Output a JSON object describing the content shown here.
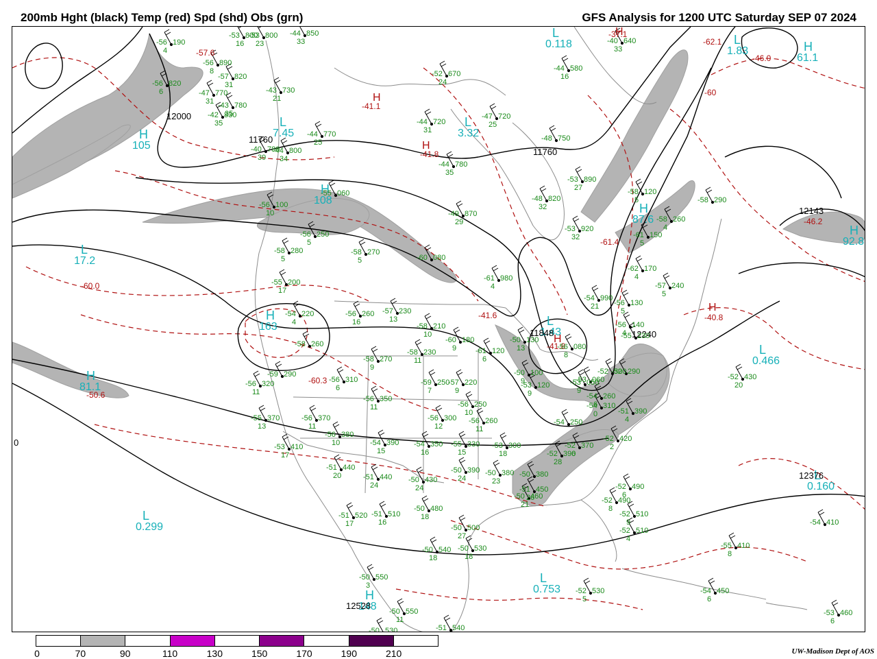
{
  "title_left": "200mb Hght (black) Temp (red) Spd (shd) Obs (grn)",
  "title_right": "GFS Analysis for 1200 UTC Saturday  SEP 07 2024",
  "credit": "UW-Madison  Dept of AOS",
  "edge_label": "0",
  "colorbar": {
    "ticks": [
      "0",
      "70",
      "90",
      "110",
      "130",
      "150",
      "170",
      "190",
      "210"
    ],
    "segments": [
      "#ffffff",
      "#b4b4b4",
      "#ffffff",
      "#c800c8",
      "#ffffff",
      "#8c008c",
      "#ffffff",
      "#500050",
      "#ffffff"
    ]
  },
  "colors": {
    "heights": "#000000",
    "temperature": "#b01010",
    "wind_speed_shading": "#b4b4b4",
    "observations": "#1a8a1a",
    "centers": "#16b0b8",
    "geography": "#8c8c8c"
  },
  "centers": [
    {
      "mark": "L",
      "value": "0.118"
    },
    {
      "mark": "L",
      "value": "1.83"
    },
    {
      "mark": "H",
      "value": "61.1"
    },
    {
      "mark": "H",
      "value": "105"
    },
    {
      "mark": "L",
      "value": "7.45"
    },
    {
      "mark": "L",
      "value": "3.32"
    },
    {
      "mark": "H",
      "value": "108"
    },
    {
      "mark": "L",
      "value": "17.2"
    },
    {
      "mark": "H",
      "value": "87.6"
    },
    {
      "mark": "H",
      "value": "92.8"
    },
    {
      "mark": "H",
      "value": "163"
    },
    {
      "mark": "L",
      "value": "1.43"
    },
    {
      "mark": "L",
      "value": "0.466"
    },
    {
      "mark": "H",
      "value": "81.1"
    },
    {
      "mark": "L",
      "value": "0.160"
    },
    {
      "mark": "L",
      "value": "0.299"
    },
    {
      "mark": "L",
      "value": "0.753"
    },
    {
      "mark": "H",
      "value": "148"
    }
  ],
  "heights": [
    "12000",
    "11760",
    "11760",
    "12143",
    "12240",
    "12376",
    "12528",
    "11848"
  ],
  "temperatures": [
    "-57.6",
    "-41.1",
    "-41.8",
    "-37.1",
    "-62.1",
    "-46.0",
    "-60",
    "-60.0",
    "-61.4",
    "-46.2",
    "-60.3",
    "-50.6",
    "-40.8",
    "-41.8",
    "-41.6"
  ],
  "temp_marks": [
    "H",
    "H",
    "H",
    "H",
    "H"
  ],
  "observations": [
    {
      "t": "-56",
      "h": "190",
      "d": "4"
    },
    {
      "t": "-53",
      "h": "800",
      "d": "16"
    },
    {
      "t": "-53",
      "h": "800",
      "d": "23"
    },
    {
      "t": "-44",
      "h": "850",
      "d": "33"
    },
    {
      "t": "-56",
      "h": "890",
      "d": "8"
    },
    {
      "t": "-57",
      "h": "820",
      "d": "31"
    },
    {
      "t": "-56",
      "h": "820",
      "d": "6"
    },
    {
      "t": "-47",
      "h": "770",
      "d": "31"
    },
    {
      "t": "-43",
      "h": "730",
      "d": "21"
    },
    {
      "t": "-43",
      "h": "780",
      "d": "35"
    },
    {
      "t": "-42",
      "h": "830",
      "d": "35"
    },
    {
      "t": "-44",
      "h": "770",
      "d": "25"
    },
    {
      "t": "-44",
      "h": "720",
      "d": "31"
    },
    {
      "t": "-47",
      "h": "720",
      "d": "25"
    },
    {
      "t": "-52",
      "h": "670",
      "d": "24"
    },
    {
      "t": "-44",
      "h": "580",
      "d": "16"
    },
    {
      "t": "-40",
      "h": "640",
      "d": "33"
    },
    {
      "t": "-48",
      "h": "750",
      "d": ""
    },
    {
      "t": "-44",
      "h": "780",
      "d": "35"
    },
    {
      "t": "-44",
      "h": "800",
      "d": "34"
    },
    {
      "t": "-40",
      "h": "780",
      "d": "39"
    },
    {
      "t": "-53",
      "h": "890",
      "d": "27"
    },
    {
      "t": "-48",
      "h": "820",
      "d": "32"
    },
    {
      "t": "-49",
      "h": "870",
      "d": "29"
    },
    {
      "t": "-53",
      "h": "920",
      "d": "32"
    },
    {
      "t": "-56",
      "h": "100",
      "d": "10"
    },
    {
      "t": "-55",
      "h": "060",
      "d": ""
    },
    {
      "t": "-56",
      "h": "250",
      "d": "5"
    },
    {
      "t": "-58",
      "h": "280",
      "d": "5"
    },
    {
      "t": "-58",
      "h": "270",
      "d": "5"
    },
    {
      "t": "-60",
      "h": "080",
      "d": ""
    },
    {
      "t": "-58",
      "h": "120",
      "d": "5"
    },
    {
      "t": "-58",
      "h": "260",
      "d": "4"
    },
    {
      "t": "-58",
      "h": "290",
      "d": ""
    },
    {
      "t": "-61",
      "h": "150",
      "d": "5"
    },
    {
      "t": "-61",
      "h": "980",
      "d": "4"
    },
    {
      "t": "-57",
      "h": "240",
      "d": "5"
    },
    {
      "t": "-56",
      "h": "130",
      "d": "5"
    },
    {
      "t": "-54",
      "h": "990",
      "d": "21"
    },
    {
      "t": "-62",
      "h": "170",
      "d": "4"
    },
    {
      "t": "-55",
      "h": "200",
      "d": "17"
    },
    {
      "t": "-54",
      "h": "220",
      "d": "4"
    },
    {
      "t": "-56",
      "h": "260",
      "d": "16"
    },
    {
      "t": "-57",
      "h": "230",
      "d": "13"
    },
    {
      "t": "-58",
      "h": "210",
      "d": "10"
    },
    {
      "t": "-60",
      "h": "180",
      "d": "9"
    },
    {
      "t": "-61",
      "h": "120",
      "d": "6"
    },
    {
      "t": "-50",
      "h": "130",
      "d": "13"
    },
    {
      "t": "-56",
      "h": "080",
      "d": "8"
    },
    {
      "t": "-56",
      "h": "140",
      "d": "4"
    },
    {
      "t": "-55",
      "h": "230",
      "d": ""
    },
    {
      "t": "-58",
      "h": "260",
      "d": ""
    },
    {
      "t": "-58",
      "h": "270",
      "d": "9"
    },
    {
      "t": "-58",
      "h": "230",
      "d": "11"
    },
    {
      "t": "-50",
      "h": "100",
      "d": "9"
    },
    {
      "t": "-53",
      "h": "120",
      "d": "9"
    },
    {
      "t": "-53",
      "h": "050",
      "d": "9"
    },
    {
      "t": "-53",
      "h": "060",
      "d": ""
    },
    {
      "t": "-52",
      "h": "300",
      "d": ""
    },
    {
      "t": "-52",
      "h": "290",
      "d": ""
    },
    {
      "t": "-59",
      "h": "290",
      "d": ""
    },
    {
      "t": "-56",
      "h": "320",
      "d": "11"
    },
    {
      "t": "-56",
      "h": "310",
      "d": "6"
    },
    {
      "t": "-56",
      "h": "350",
      "d": "11"
    },
    {
      "t": "-59",
      "h": "250",
      "d": "7"
    },
    {
      "t": "-57",
      "h": "220",
      "d": "9"
    },
    {
      "t": "-56",
      "h": "250",
      "d": "10"
    },
    {
      "t": "-56",
      "h": "300",
      "d": "12"
    },
    {
      "t": "-56",
      "h": "260",
      "d": "11"
    },
    {
      "t": "-54",
      "h": "260",
      "d": "6"
    },
    {
      "t": "-54",
      "h": "310",
      "d": "0"
    },
    {
      "t": "-51",
      "h": "390",
      "d": "4"
    },
    {
      "t": "-54",
      "h": "250",
      "d": ""
    },
    {
      "t": "-55",
      "h": "370",
      "d": "13"
    },
    {
      "t": "-56",
      "h": "370",
      "d": "11"
    },
    {
      "t": "-56",
      "h": "380",
      "d": "10"
    },
    {
      "t": "-53",
      "h": "410",
      "d": "17"
    },
    {
      "t": "-54",
      "h": "390",
      "d": "15"
    },
    {
      "t": "-54",
      "h": "350",
      "d": "16"
    },
    {
      "t": "-55",
      "h": "330",
      "d": "15"
    },
    {
      "t": "-53",
      "h": "300",
      "d": "18"
    },
    {
      "t": "-52",
      "h": "420",
      "d": "2"
    },
    {
      "t": "-52",
      "h": "370",
      "d": "6"
    },
    {
      "t": "-52",
      "h": "390",
      "d": "28"
    },
    {
      "t": "-51",
      "h": "440",
      "d": "20"
    },
    {
      "t": "-51",
      "h": "440",
      "d": "24"
    },
    {
      "t": "-50",
      "h": "430",
      "d": "24"
    },
    {
      "t": "-50",
      "h": "390",
      "d": "24"
    },
    {
      "t": "-50",
      "h": "380",
      "d": "23"
    },
    {
      "t": "-50",
      "h": "380",
      "d": ""
    },
    {
      "t": "-52",
      "h": "490",
      "d": "6"
    },
    {
      "t": "-52",
      "h": "490",
      "d": "8"
    },
    {
      "t": "-50",
      "h": "460",
      "d": "21"
    },
    {
      "t": "-51",
      "h": "450",
      "d": "26"
    },
    {
      "t": "-51",
      "h": "520",
      "d": "17"
    },
    {
      "t": "-51",
      "h": "510",
      "d": "16"
    },
    {
      "t": "-50",
      "h": "480",
      "d": "18"
    },
    {
      "t": "-50",
      "h": "500",
      "d": "27"
    },
    {
      "t": "-52",
      "h": "510",
      "d": "9"
    },
    {
      "t": "-52",
      "h": "510",
      "d": "4"
    },
    {
      "t": "-54",
      "h": "410",
      "d": ""
    },
    {
      "t": "-55",
      "h": "410",
      "d": "8"
    },
    {
      "t": "-50",
      "h": "540",
      "d": "18"
    },
    {
      "t": "-50",
      "h": "530",
      "d": "18"
    },
    {
      "t": "-50",
      "h": "550",
      "d": "3"
    },
    {
      "t": "-52",
      "h": "530",
      "d": "5"
    },
    {
      "t": "-54",
      "h": "450",
      "d": "6"
    },
    {
      "t": "-50",
      "h": "550",
      "d": "11"
    },
    {
      "t": "-50",
      "h": "530",
      "d": ""
    },
    {
      "t": "-51",
      "h": "540",
      "d": ""
    },
    {
      "t": "-53",
      "h": "460",
      "d": "6"
    },
    {
      "t": "-52",
      "h": "430",
      "d": "20"
    }
  ]
}
